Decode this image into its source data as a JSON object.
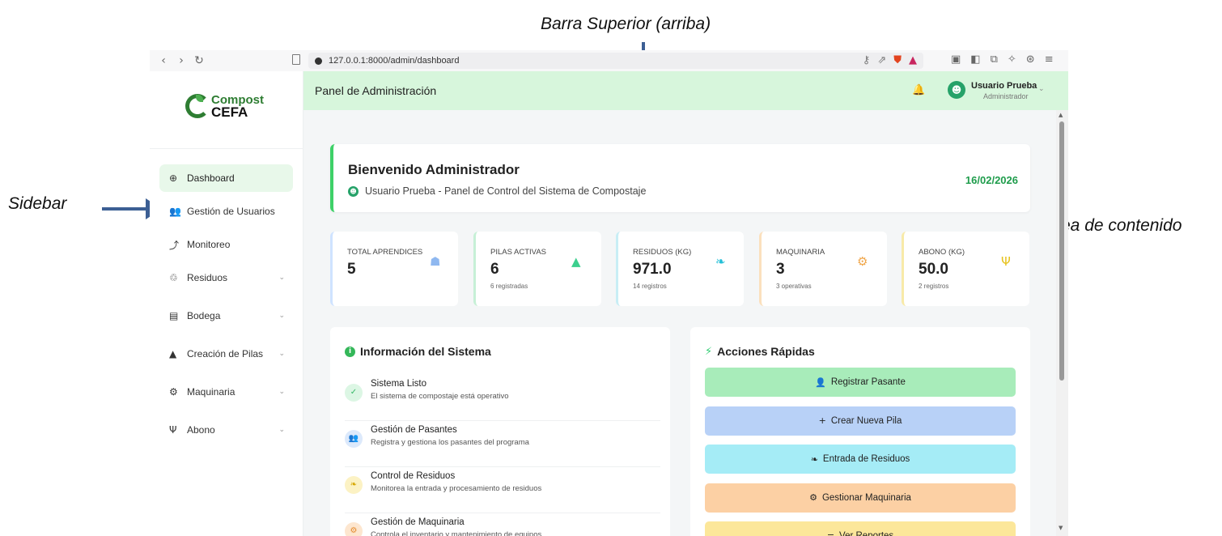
{
  "annotations": {
    "top": "Barra Superior (arriba)",
    "sidebar": "Sidebar",
    "content": "Area de contenido"
  },
  "browser": {
    "url": "127.0.0.1:8000/admin/dashboard"
  },
  "sidebar": {
    "logo_line1": "Compost",
    "logo_line2": "CEFA",
    "items": [
      {
        "label": "Dashboard",
        "icon": "globe-icon",
        "glyph": "⊕",
        "active": true,
        "has_chevron": false
      },
      {
        "label": "Gestión de Usuarios",
        "icon": "users-icon",
        "glyph": "👥",
        "active": false,
        "has_chevron": false
      },
      {
        "label": "Monitoreo",
        "icon": "chart-line-icon",
        "glyph": "⤴",
        "active": false,
        "has_chevron": false
      },
      {
        "label": "Residuos",
        "icon": "recycle-icon",
        "glyph": "♲",
        "active": false,
        "has_chevron": true
      },
      {
        "label": "Bodega",
        "icon": "warehouse-icon",
        "glyph": "▤",
        "active": false,
        "has_chevron": true
      },
      {
        "label": "Creación de Pilas",
        "icon": "mountain-icon",
        "glyph": "▲",
        "active": false,
        "has_chevron": true
      },
      {
        "label": "Maquinaria",
        "icon": "cogs-icon",
        "glyph": "⚙",
        "active": false,
        "has_chevron": true
      },
      {
        "label": "Abono",
        "icon": "seedling-icon",
        "glyph": "Ψ",
        "active": false,
        "has_chevron": true
      }
    ]
  },
  "topbar": {
    "title": "Panel de Administración",
    "user_name": "Usuario Prueba",
    "user_role": "Administrador"
  },
  "welcome": {
    "title": "Bienvenido Administrador",
    "subtitle": "Usuario Prueba - Panel de Control del Sistema de Compostaje",
    "date": "16/02/2026"
  },
  "stats": [
    {
      "label": "TOTAL APRENDICES",
      "value": "5",
      "note": "",
      "icon": "graduate-icon",
      "glyph": "☗",
      "color": "#8fb8f0",
      "border": "#cfe3ff"
    },
    {
      "label": "PILAS ACTIVAS",
      "value": "6",
      "note": "6 registradas",
      "icon": "mountain-icon",
      "glyph": "▲",
      "color": "#3ccf8e",
      "border": "#c6f0d6"
    },
    {
      "label": "RESIDUOS (KG)",
      "value": "971.0",
      "note": "14 registros",
      "icon": "leaf-icon",
      "glyph": "❧",
      "color": "#26c0d8",
      "border": "#c8eef5"
    },
    {
      "label": "MAQUINARIA",
      "value": "3",
      "note": "3 operativas",
      "icon": "cogs-icon",
      "glyph": "⚙",
      "color": "#f0a64a",
      "border": "#fbe0bd"
    },
    {
      "label": "ABONO (KG)",
      "value": "50.0",
      "note": "2 registros",
      "icon": "seedling-icon",
      "glyph": "Ψ",
      "color": "#e7c21d",
      "border": "#f8eaa8"
    }
  ],
  "info": {
    "title": "Información del Sistema",
    "items": [
      {
        "title": "Sistema Listo",
        "desc": "El sistema de compostaje está operativo",
        "icon": "check-icon",
        "glyph": "✓",
        "bg": "#dcf6e4",
        "fg": "#35b866"
      },
      {
        "title": "Gestión de Pasantes",
        "desc": "Registra y gestiona los pasantes del programa",
        "icon": "users-icon",
        "glyph": "👥",
        "bg": "#dce9fb",
        "fg": "#4a7fd0"
      },
      {
        "title": "Control de Residuos",
        "desc": "Monitorea la entrada y procesamiento de residuos",
        "icon": "leaf-icon",
        "glyph": "❧",
        "bg": "#fcf2c4",
        "fg": "#d6a700"
      },
      {
        "title": "Gestión de Maquinaria",
        "desc": "Controla el inventario y mantenimiento de equipos",
        "icon": "cogs-icon",
        "glyph": "⚙",
        "bg": "#fde6cf",
        "fg": "#e48a2c"
      }
    ]
  },
  "actions": {
    "title": "Acciones Rápidas",
    "buttons": [
      {
        "label": "Registrar Pasante",
        "icon": "user-plus-icon",
        "glyph": "👤",
        "bg": "#a8ecba"
      },
      {
        "label": "Crear Nueva Pila",
        "icon": "plus-icon",
        "glyph": "+",
        "bg": "#b8d1f7"
      },
      {
        "label": "Entrada de Residuos",
        "icon": "leaf-icon",
        "glyph": "❧",
        "bg": "#a5ecf6"
      },
      {
        "label": "Gestionar Maquinaria",
        "icon": "cogs-icon",
        "glyph": "⚙",
        "bg": "#fcd0a4"
      },
      {
        "label": "Ver Reportes",
        "icon": "list-icon",
        "glyph": "≡",
        "bg": "#fce79a"
      }
    ]
  }
}
